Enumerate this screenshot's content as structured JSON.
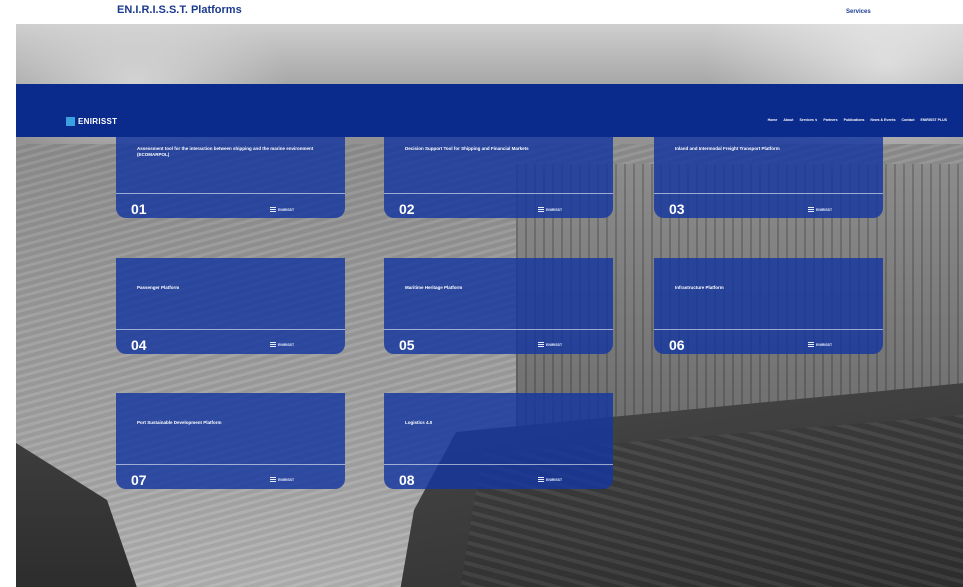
{
  "page": {
    "heading": "EN.I.R.I.S.S.T. Platforms",
    "top_link": "Services"
  },
  "navbar": {
    "brand": "ENIRISST",
    "links": [
      "Home",
      "About",
      "Services ∨",
      "Partners",
      "Publications",
      "News & Events",
      "Contact",
      "ENIRISST PLUS"
    ]
  },
  "cards": [
    {
      "number": "01",
      "title": "Assessment tool for the interaction between shipping and the marine environment (ECOMARPOL)",
      "logo": "ENIRISST"
    },
    {
      "number": "02",
      "title": "Decision Support Tool for Shipping and Financial Markets",
      "logo": "ENIRISST"
    },
    {
      "number": "03",
      "title": "Inland and Intermodal Freight Transport Platform",
      "logo": "ENIRISST"
    },
    {
      "number": "04",
      "title": "Passenger Platform",
      "logo": "ENIRISST"
    },
    {
      "number": "05",
      "title": "Maritime Heritage Platform",
      "logo": "ENIRISST"
    },
    {
      "number": "06",
      "title": "Infrastructure Platform",
      "logo": "ENIRISST"
    },
    {
      "number": "07",
      "title": "Port Sustainable Development Platform",
      "logo": "ENIRISST"
    },
    {
      "number": "08",
      "title": "Logistics 4.0",
      "logo": "ENIRISST"
    }
  ],
  "colors": {
    "navbar": "#0a2a8c",
    "card": "#1437a0",
    "heading": "#1a3a8f",
    "brand_icon": "#3aa0e0"
  }
}
